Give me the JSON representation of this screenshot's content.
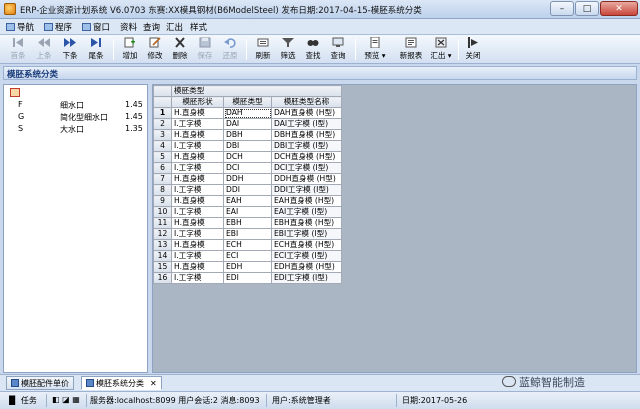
{
  "window": {
    "title": "ERP-企业资源计划系统 V6.0703 东赛:XX模具钢材(B6ModelSteel) 发布日期:2017-04-15-模胚系统分类",
    "controls": {
      "minimize": "–",
      "maximize": "□",
      "close": "✕"
    }
  },
  "menu": {
    "items": [
      {
        "label": "导航",
        "icon": "nav-icon"
      },
      {
        "label": "程序",
        "icon": "program-icon"
      },
      {
        "label": "窗口",
        "icon": "window-icon"
      },
      {
        "label": "资料"
      },
      {
        "label": "查询"
      },
      {
        "label": "汇出"
      },
      {
        "label": "样式"
      }
    ]
  },
  "toolbar": {
    "buttons": [
      {
        "id": "first",
        "label": "首条",
        "icon": "first-record-icon",
        "enabled": false
      },
      {
        "id": "prev",
        "label": "上条",
        "icon": "prev-record-icon",
        "enabled": false
      },
      {
        "id": "next",
        "label": "下条",
        "icon": "next-record-icon",
        "enabled": true
      },
      {
        "id": "last",
        "label": "尾条",
        "icon": "last-record-icon",
        "enabled": true
      },
      {
        "id": "add",
        "label": "增加",
        "icon": "add-icon",
        "enabled": true
      },
      {
        "id": "edit",
        "label": "修改",
        "icon": "edit-icon",
        "enabled": true
      },
      {
        "id": "delete",
        "label": "删除",
        "icon": "delete-icon",
        "enabled": true
      },
      {
        "id": "save",
        "label": "保存",
        "icon": "save-icon",
        "enabled": false
      },
      {
        "id": "undo",
        "label": "还原",
        "icon": "undo-icon",
        "enabled": false
      },
      {
        "id": "refresh",
        "label": "刷新",
        "icon": "refresh-icon",
        "enabled": true
      },
      {
        "id": "filter",
        "label": "筛选",
        "icon": "filter-icon",
        "enabled": true
      },
      {
        "id": "find",
        "label": "查找",
        "icon": "find-icon",
        "enabled": true
      },
      {
        "id": "query",
        "label": "查询",
        "icon": "query-icon",
        "enabled": true
      },
      {
        "id": "preview",
        "label": "预览",
        "icon": "preview-icon",
        "enabled": true
      },
      {
        "id": "new-report",
        "label": "新报表",
        "icon": "new-report-icon",
        "enabled": true
      },
      {
        "id": "export",
        "label": "汇出",
        "icon": "export-icon",
        "enabled": true
      },
      {
        "id": "close",
        "label": "关闭",
        "icon": "close-window-icon",
        "enabled": true
      }
    ]
  },
  "section": {
    "title": "模胚系统分类"
  },
  "left_tree": {
    "rows": [
      {
        "code": "F",
        "name": "细水口",
        "value": "1.45"
      },
      {
        "code": "G",
        "name": "简化型细水口",
        "value": "1.45"
      },
      {
        "code": "S",
        "name": "大水口",
        "value": "1.35"
      }
    ]
  },
  "grid": {
    "group_header": "模胚类型",
    "columns": [
      "模胚形状",
      "模胚类型",
      "模胚类型名称"
    ],
    "rows": [
      {
        "n": "1",
        "shape": "H.直身模",
        "type": "DAH",
        "name": "DAH直身模 (H型)"
      },
      {
        "n": "2",
        "shape": "I.工字模",
        "type": "DAI",
        "name": "DAI工字模 (I型)"
      },
      {
        "n": "3",
        "shape": "H.直身模",
        "type": "DBH",
        "name": "DBH直身模 (H型)"
      },
      {
        "n": "4",
        "shape": "I.工字模",
        "type": "DBI",
        "name": "DBI工字模 (I型)"
      },
      {
        "n": "5",
        "shape": "H.直身模",
        "type": "DCH",
        "name": "DCH直身模 (H型)"
      },
      {
        "n": "6",
        "shape": "I.工字模",
        "type": "DCI",
        "name": "DCI工字模 (I型)"
      },
      {
        "n": "7",
        "shape": "H.直身模",
        "type": "DDH",
        "name": "DDH直身模 (H型)"
      },
      {
        "n": "8",
        "shape": "I.工字模",
        "type": "DDI",
        "name": "DDI工字模 (I型)"
      },
      {
        "n": "9",
        "shape": "H.直身模",
        "type": "EAH",
        "name": "EAH直身模 (H型)"
      },
      {
        "n": "10",
        "shape": "I.工字模",
        "type": "EAI",
        "name": "EAI工字模 (I型)"
      },
      {
        "n": "11",
        "shape": "H.直身模",
        "type": "EBH",
        "name": "EBH直身模 (H型)"
      },
      {
        "n": "12",
        "shape": "I.工字模",
        "type": "EBI",
        "name": "EBI工字模 (I型)"
      },
      {
        "n": "13",
        "shape": "H.直身模",
        "type": "ECH",
        "name": "ECH直身模 (H型)"
      },
      {
        "n": "14",
        "shape": "I.工字模",
        "type": "ECI",
        "name": "ECI工字模 (I型)"
      },
      {
        "n": "15",
        "shape": "H.直身模",
        "type": "EDH",
        "name": "EDH直身模 (H型)"
      },
      {
        "n": "16",
        "shape": "I.工字模",
        "type": "EDI",
        "name": "EDI工字模 (I型)"
      }
    ]
  },
  "tabs": [
    {
      "label": "模胚配件单价",
      "active": false
    },
    {
      "label": "模胚系统分类",
      "active": true
    }
  ],
  "watermark": {
    "text": "蓝鲸智能制造"
  },
  "status": {
    "task": "任务",
    "server": "服务器:localhost:8099 用户会话:2 消息:8093",
    "user": "用户:系统管理者",
    "date": "日期:2017-05-26"
  },
  "colors": {
    "accent": "#1a3c7a",
    "selection": "#316ac5",
    "chrome": "#c9d8ec"
  }
}
